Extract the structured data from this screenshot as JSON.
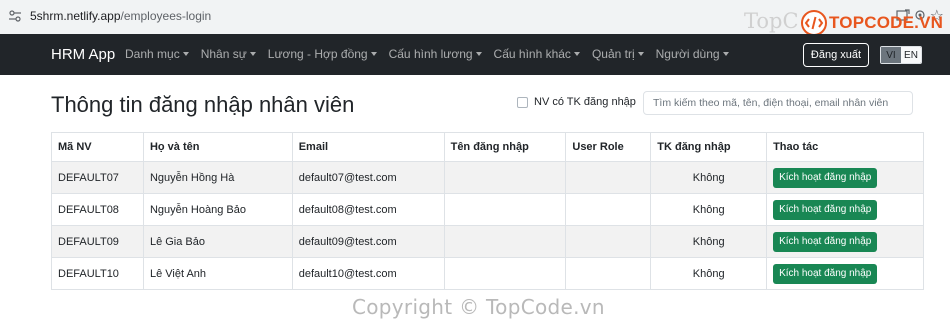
{
  "browser": {
    "url_host": "5shrm.netlify.app",
    "url_path": "/employees-login"
  },
  "watermark": {
    "top": "TopC",
    "logo_text": "TOPCODE.VN",
    "bottom": "Copyright © TopCode.vn"
  },
  "navbar": {
    "brand": "HRM App",
    "menu": [
      {
        "label": "Danh mục"
      },
      {
        "label": "Nhân sự"
      },
      {
        "label": "Lương - Hợp đồng"
      },
      {
        "label": "Cấu hình lương"
      },
      {
        "label": "Cấu hình khác"
      },
      {
        "label": "Quản trị"
      },
      {
        "label": "Người dùng"
      }
    ],
    "logout_label": "Đăng xuất",
    "lang_vi": "VI",
    "lang_en": "EN"
  },
  "page": {
    "title": "Thông tin đăng nhập nhân viên",
    "filter_label": "NV có TK đăng nhập",
    "search_placeholder": "Tìm kiếm theo mã, tên, điện thoại, email nhân viên"
  },
  "table": {
    "headers": [
      "Mã NV",
      "Họ và tên",
      "Email",
      "Tên đăng nhập",
      "User Role",
      "TK đăng nhập",
      "Thao tác"
    ],
    "rows": [
      {
        "code": "DEFAULT07",
        "name": "Nguyễn Hồng Hà",
        "email": "default07@test.com",
        "username": "",
        "role": "",
        "has_account": "Không",
        "action": "Kích hoạt đăng nhập"
      },
      {
        "code": "DEFAULT08",
        "name": "Nguyễn Hoàng Bảo",
        "email": "default08@test.com",
        "username": "",
        "role": "",
        "has_account": "Không",
        "action": "Kích hoạt đăng nhập"
      },
      {
        "code": "DEFAULT09",
        "name": "Lê Gia Bảo",
        "email": "default09@test.com",
        "username": "",
        "role": "",
        "has_account": "Không",
        "action": "Kích hoạt đăng nhập"
      },
      {
        "code": "DEFAULT10",
        "name": "Lê Việt Anh",
        "email": "default10@test.com",
        "username": "",
        "role": "",
        "has_account": "Không",
        "action": "Kích hoạt đăng nhập"
      }
    ]
  },
  "colors": {
    "navbar_bg": "#212529",
    "action_green": "#198754",
    "stripe": "#f2f2f2",
    "logo_orange": "#e8561e"
  }
}
